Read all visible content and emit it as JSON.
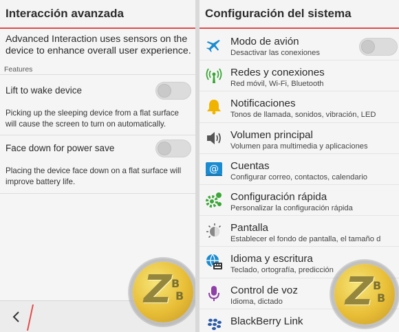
{
  "left_screen": {
    "title": "Interacción avanzada",
    "intro": "Advanced Interaction uses sensors on the device to enhance overall user experience.",
    "section_label": "Features",
    "settings": [
      {
        "label": "Lift to wake device",
        "enabled": false,
        "description": "Picking up the sleeping device from a flat surface will cause the screen to turn on automatically."
      },
      {
        "label": "Face down for power save",
        "enabled": false,
        "description": "Placing the device face down on a flat surface will improve battery life."
      }
    ],
    "bottom_bar": {
      "back_icon": "chevron-left-icon"
    }
  },
  "right_screen": {
    "title": "Configuración del sistema",
    "items": [
      {
        "title": "Modo de avión",
        "subtitle": "Desactivar las conexiones",
        "icon": "airplane-icon",
        "icon_color": "#1a8bd0",
        "has_toggle": true,
        "enabled": false
      },
      {
        "title": "Redes y conexiones",
        "subtitle": "Red móvil, Wi-Fi, Bluetooth",
        "icon": "antenna-icon",
        "icon_color": "#3aa635"
      },
      {
        "title": "Notificaciones",
        "subtitle": "Tonos de llamada, sonidos, vibración, LED",
        "icon": "bell-icon",
        "icon_color": "#f0b400"
      },
      {
        "title": "Volumen principal",
        "subtitle": "Volumen para multimedia y aplicaciones",
        "icon": "speaker-icon",
        "icon_color": "#555555"
      },
      {
        "title": "Cuentas",
        "subtitle": "Configurar correo, contactos, calendario",
        "icon": "at-sign-icon",
        "icon_color": "#1a8bd0"
      },
      {
        "title": "Configuración rápida",
        "subtitle": "Personalizar la configuración rápida",
        "icon": "quick-settings-icon",
        "icon_color": "#3aa635"
      },
      {
        "title": "Pantalla",
        "subtitle": "Establecer el fondo de pantalla, el tamaño d",
        "icon": "brightness-icon",
        "icon_color": "#666666"
      },
      {
        "title": "Idioma y escritura",
        "subtitle": "Teclado, ortografía, predicción",
        "icon": "globe-keyboard-icon",
        "icon_color": "#1a8bd0"
      },
      {
        "title": "Control de voz",
        "subtitle": "Idioma, dictado",
        "icon": "microphone-icon",
        "icon_color": "#8e3fa8"
      },
      {
        "title": "BlackBerry Link",
        "subtitle": "",
        "icon": "blackberry-icon",
        "icon_color": "#2a5aa8"
      }
    ]
  },
  "watermark": {
    "letter": "Z",
    "sub1": "B",
    "sub2": "B"
  },
  "colors": {
    "accent_red": "#e24a4a",
    "background": "#f5f5f5",
    "watermark_gold": "#e8b923"
  }
}
